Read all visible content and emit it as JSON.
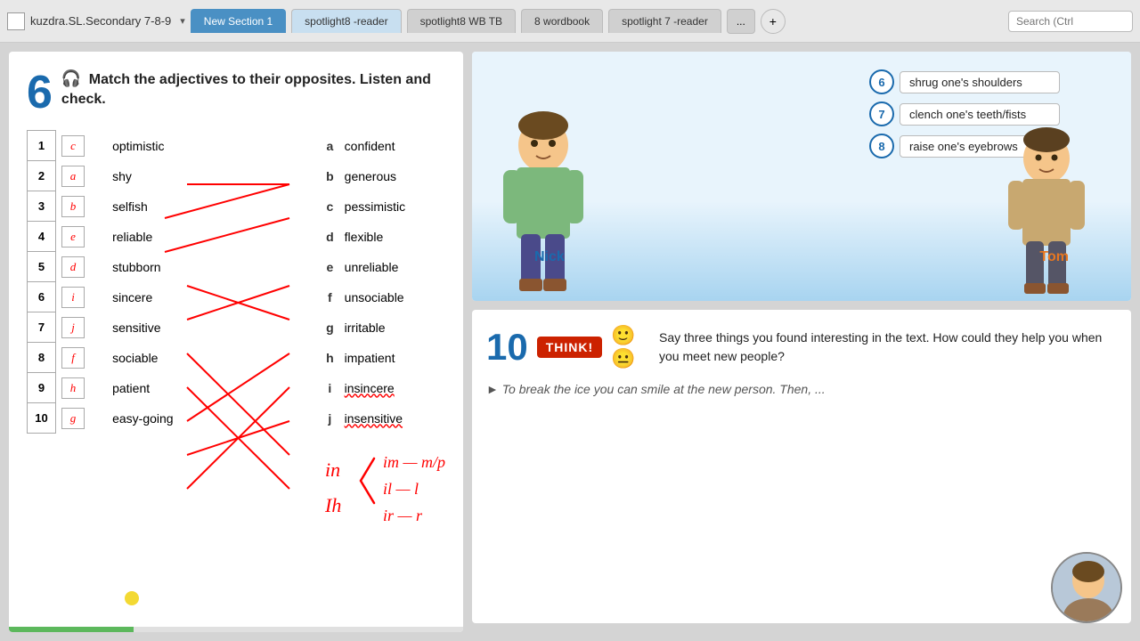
{
  "topbar": {
    "window_title": "kuzdra.SL.Secondary 7-8-9",
    "tabs": [
      {
        "label": "New Section 1",
        "state": "active"
      },
      {
        "label": "spotlight8 -reader",
        "state": "light"
      },
      {
        "label": "spotlight8 WB TB",
        "state": "inactive"
      },
      {
        "label": "8 wordbook",
        "state": "inactive"
      },
      {
        "label": "spotlight 7 -reader",
        "state": "inactive"
      },
      {
        "label": "...",
        "state": "more"
      },
      {
        "label": "+",
        "state": "plus"
      }
    ],
    "search_placeholder": "Search (Ctrl"
  },
  "exercise6": {
    "number": "6",
    "title": "Match the adjectives to their opposites. Listen and check.",
    "rows": [
      {
        "num": 1,
        "letter_box": "c",
        "left_word": "optimistic",
        "right_letter": "a",
        "right_word": "confident"
      },
      {
        "num": 2,
        "letter_box": "a",
        "left_word": "shy",
        "right_letter": "b",
        "right_word": "generous"
      },
      {
        "num": 3,
        "letter_box": "b",
        "left_word": "selfish",
        "right_letter": "c",
        "right_word": "pessimistic"
      },
      {
        "num": 4,
        "letter_box": "e",
        "left_word": "reliable",
        "right_letter": "d",
        "right_word": "flexible"
      },
      {
        "num": 5,
        "letter_box": "d",
        "left_word": "stubborn",
        "right_letter": "e",
        "right_word": "unreliable"
      },
      {
        "num": 6,
        "letter_box": "i",
        "left_word": "sincere",
        "right_letter": "f",
        "right_word": "unsociable"
      },
      {
        "num": 7,
        "letter_box": "j",
        "left_word": "sensitive",
        "right_letter": "g",
        "right_word": "irritable"
      },
      {
        "num": 8,
        "letter_box": "f",
        "left_word": "sociable",
        "right_letter": "h",
        "right_word": "impatient"
      },
      {
        "num": 9,
        "letter_box": "h",
        "left_word": "patient",
        "right_letter": "i",
        "right_word": "insincere"
      },
      {
        "num": 10,
        "letter_box": "g",
        "left_word": "easy-going",
        "right_letter": "j",
        "right_word": "insensitive"
      }
    ]
  },
  "illustration": {
    "items": [
      {
        "num": "6",
        "text": "shrug one's shoulders"
      },
      {
        "num": "7",
        "text": "clench one's teeth/fists"
      },
      {
        "num": "8",
        "text": "raise one's eyebrows"
      }
    ],
    "nick_label": "Nick",
    "tom_label": "Tom"
  },
  "exercise10": {
    "number": "10",
    "think_label": "THINK!",
    "question": "Say three things you found interesting in the text. How could they help you when you meet new people?",
    "answer": "► To break the ice you can smile at the new person. Then, ..."
  },
  "handwriting": {
    "text": "in < im—m/p\n      il—l\n      ir—r"
  }
}
